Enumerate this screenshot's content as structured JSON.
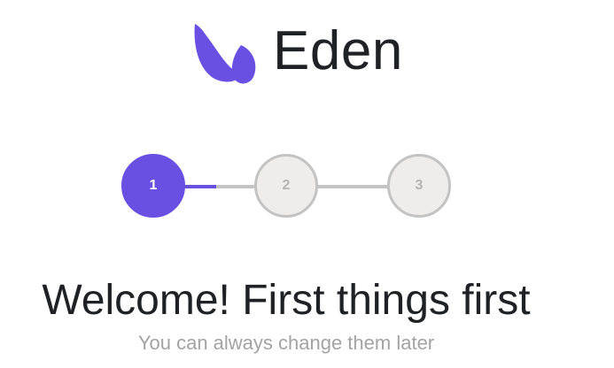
{
  "brand": {
    "name": "Eden",
    "logo_icon": "eden-leaf-logo-icon",
    "accent_color": "#6a4fe3"
  },
  "stepper": {
    "steps": [
      {
        "label": "1",
        "state": "active"
      },
      {
        "label": "2",
        "state": "pending"
      },
      {
        "label": "3",
        "state": "pending"
      }
    ],
    "connector_progress": [
      0.45,
      0
    ],
    "active_color": "#6a4fe3",
    "pending_color": "#eeedeb"
  },
  "main": {
    "title": "Welcome! First things first",
    "subtitle": "You can always change them later"
  }
}
